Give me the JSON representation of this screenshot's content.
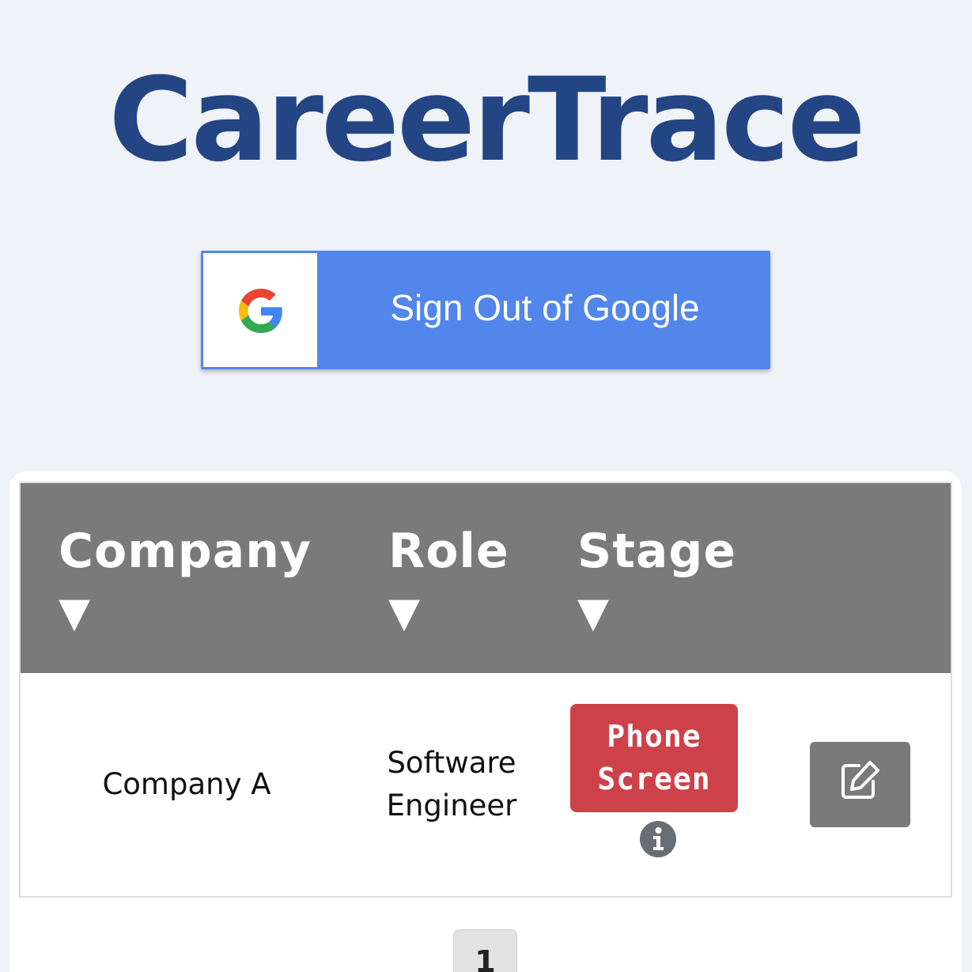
{
  "app": {
    "title": "CareerTrace"
  },
  "auth": {
    "button_label": "Sign Out of Google",
    "icon": "google-g-icon",
    "button_color": "#5286eb"
  },
  "table": {
    "columns": [
      {
        "label": "Company",
        "sort_indicator": "▼"
      },
      {
        "label": "Role",
        "sort_indicator": "▼"
      },
      {
        "label": "Stage",
        "sort_indicator": "▼"
      }
    ],
    "header_color": "#7a7a7a",
    "rows": [
      {
        "company": "Company A",
        "role_line1": "Software",
        "role_line2": "Engineer",
        "stage_line1": "Phone",
        "stage_line2": "Screen",
        "stage_color": "#cd424a",
        "info_icon": "info-circle-icon",
        "edit_icon": "edit-square-icon"
      }
    ]
  },
  "pagination": {
    "current_page": "1"
  },
  "colors": {
    "title": "#234584",
    "background": "#eff2f7"
  }
}
